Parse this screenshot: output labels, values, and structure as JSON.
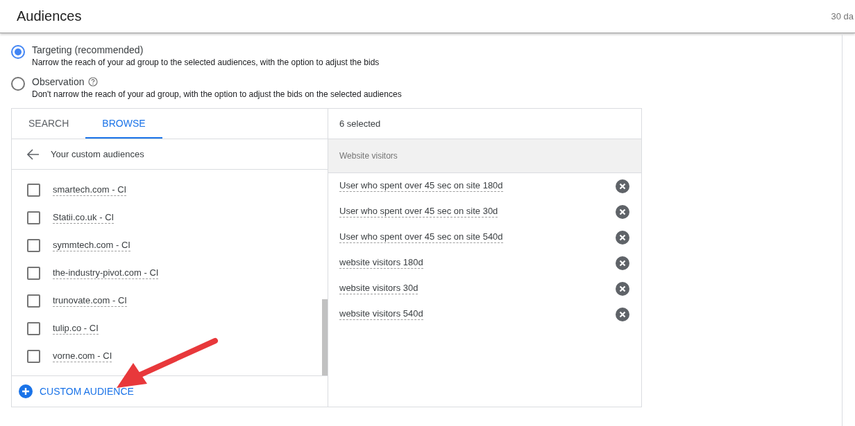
{
  "header": {
    "title": "Audiences",
    "range": "30 da"
  },
  "options": [
    {
      "label": "Targeting (recommended)",
      "description": "Narrow the reach of your ad group to the selected audiences, with the option to adjust the bids",
      "selected": true,
      "help": false
    },
    {
      "label": "Observation",
      "description": "Don't narrow the reach of your ad group, with the option to adjust the bids on the selected audiences",
      "selected": false,
      "help": true
    }
  ],
  "tabs": [
    {
      "label": "SEARCH",
      "selected": false
    },
    {
      "label": "BROWSE",
      "selected": true
    }
  ],
  "breadcrumb": "Your custom audiences",
  "audiences": [
    {
      "label": "smartech.com - CI",
      "checked": false
    },
    {
      "label": "Statii.co.uk - CI",
      "checked": false
    },
    {
      "label": "symmtech.com - CI",
      "checked": false
    },
    {
      "label": "the-industry-pivot.com - CI",
      "checked": false
    },
    {
      "label": "trunovate.com - CI",
      "checked": false
    },
    {
      "label": "tulip.co - CI",
      "checked": false
    },
    {
      "label": "vorne.com - CI",
      "checked": false
    }
  ],
  "add_button": "CUSTOM AUDIENCE",
  "selected_panel": {
    "count": "6 selected",
    "group": "Website visitors",
    "items": [
      "User who spent over 45 sec on site 180d",
      "User who spent over 45 sec on site 30d",
      "User who spent over 45 sec on site 540d",
      "website visitors 180d",
      "website visitors 30d",
      "website visitors 540d"
    ]
  }
}
